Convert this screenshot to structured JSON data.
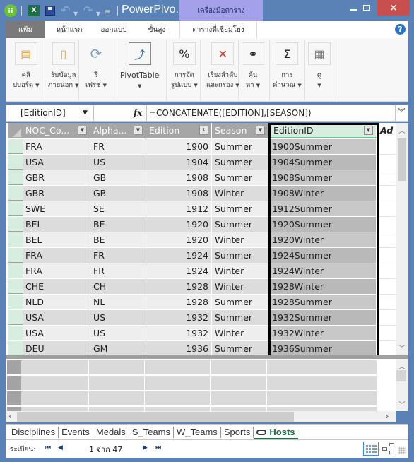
{
  "window": {
    "title": "PowerPivo...",
    "context_tab": "เครื่องมือตาราง",
    "app_icon": "powerpivot-icon",
    "close_label": "×"
  },
  "qat": {
    "excel_icon": "X",
    "undo": "↶",
    "redo": "↷"
  },
  "ribbon": {
    "tabs": [
      {
        "label": "แฟ้ม",
        "active": true
      },
      {
        "label": "หน้าแรก"
      },
      {
        "label": "ออกแบบ"
      },
      {
        "label": "ขั้นสูง"
      },
      {
        "label": "ตารางที่เชื่อมโยง"
      }
    ],
    "help": "?",
    "buttons": [
      {
        "line1": "คลิ",
        "line2": "ปบอร์ด",
        "icon": "clipboard-icon",
        "glyph": "📋"
      },
      {
        "line1": "รับข้อมูล",
        "line2": "ภายนอก",
        "icon": "external-data-icon",
        "glyph": "🗎"
      },
      {
        "line1": "รี",
        "line2": "เฟรช",
        "icon": "refresh-icon",
        "glyph": "⟳"
      },
      {
        "line1": "PivotTable",
        "line2": "",
        "icon": "pivottable-icon",
        "glyph": "⤴"
      },
      {
        "line1": "การจัด",
        "line2": "รูปแบบ",
        "icon": "percent-icon",
        "glyph": "%"
      },
      {
        "line1": "เรียงลำดับ",
        "line2": "และกรอง",
        "icon": "filter-clear-icon",
        "glyph": "✕"
      },
      {
        "line1": "ค้น",
        "line2": "หา",
        "icon": "binoculars-icon",
        "glyph": "⚲"
      },
      {
        "line1": "การ",
        "line2": "คำนวณ",
        "icon": "sigma-icon",
        "glyph": "Σ"
      },
      {
        "line1": "ดู",
        "line2": "",
        "icon": "view-icon",
        "glyph": "▦"
      }
    ]
  },
  "formula_bar": {
    "name_box": "[EditionID]",
    "fx": "fx",
    "formula": "=CONCATENATE([EDITION],[SEASON])",
    "expand": "»"
  },
  "table": {
    "columns": [
      {
        "label": "NOC_Co...",
        "filter": "▾"
      },
      {
        "label": "Alpha...",
        "filter": "▾"
      },
      {
        "label": "Edition",
        "filter": "↓"
      },
      {
        "label": "Season",
        "filter": "▾"
      },
      {
        "label": "EditionID",
        "filter": "▾",
        "selected": true
      },
      {
        "label": "Ad"
      }
    ],
    "rows": [
      [
        "FRA",
        "FR",
        "1900",
        "Summer",
        "1900Summer"
      ],
      [
        "USA",
        "US",
        "1904",
        "Summer",
        "1904Summer"
      ],
      [
        "GBR",
        "GB",
        "1908",
        "Summer",
        "1908Summer"
      ],
      [
        "GBR",
        "GB",
        "1908",
        "Winter",
        "1908Winter"
      ],
      [
        "SWE",
        "SE",
        "1912",
        "Summer",
        "1912Summer"
      ],
      [
        "BEL",
        "BE",
        "1920",
        "Summer",
        "1920Summer"
      ],
      [
        "BEL",
        "BE",
        "1920",
        "Winter",
        "1920Winter"
      ],
      [
        "FRA",
        "FR",
        "1924",
        "Summer",
        "1924Summer"
      ],
      [
        "FRA",
        "FR",
        "1924",
        "Winter",
        "1924Winter"
      ],
      [
        "CHE",
        "CH",
        "1928",
        "Winter",
        "1928Winter"
      ],
      [
        "NLD",
        "NL",
        "1928",
        "Summer",
        "1928Summer"
      ],
      [
        "USA",
        "US",
        "1932",
        "Summer",
        "1932Summer"
      ],
      [
        "USA",
        "US",
        "1932",
        "Winter",
        "1932Winter"
      ],
      [
        "DEU",
        "GM",
        "1936",
        "Summer",
        "1936Summer"
      ]
    ]
  },
  "sheet_tabs": [
    {
      "label": "Disciplines"
    },
    {
      "label": "Events"
    },
    {
      "label": "Medals"
    },
    {
      "label": "S_Teams"
    },
    {
      "label": "W_Teams"
    },
    {
      "label": "Sports"
    },
    {
      "label": "Hosts",
      "active": true,
      "linked": true
    }
  ],
  "status": {
    "record_label": "ระเบียน:",
    "record_text": "1 จาก 47",
    "first": "⏮",
    "prev": "◀",
    "next": "▶",
    "last": "⏭"
  },
  "colors": {
    "window_chrome": "#5a82b6",
    "context_tab": "#a4a0ea",
    "accent_green": "#1e7145",
    "close": "#c7504f"
  }
}
